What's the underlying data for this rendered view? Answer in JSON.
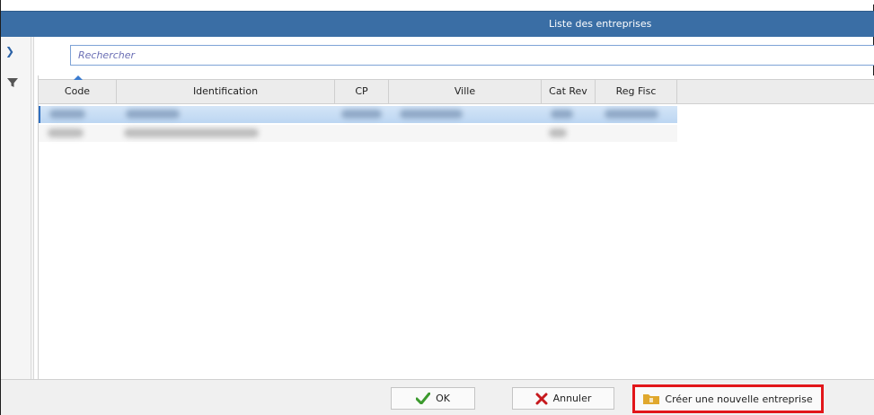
{
  "window": {
    "title": "Liste des entreprises",
    "accent_color": "#3a6ea5"
  },
  "search": {
    "placeholder": "Rechercher",
    "value": ""
  },
  "table": {
    "columns": [
      "Code",
      "Identification",
      "CP",
      "Ville",
      "Cat Rev",
      "Reg Fisc"
    ],
    "sorted_column": "Code",
    "selected_row": 0,
    "rows_note_blurred": true
  },
  "buttons": {
    "ok": "OK",
    "cancel": "Annuler",
    "create": "Créer une nouvelle entreprise"
  },
  "icons": {
    "expand": "chevron-right-icon",
    "filter": "funnel-icon",
    "ok": "check-icon",
    "cancel": "x-icon",
    "create": "folder-icon"
  }
}
